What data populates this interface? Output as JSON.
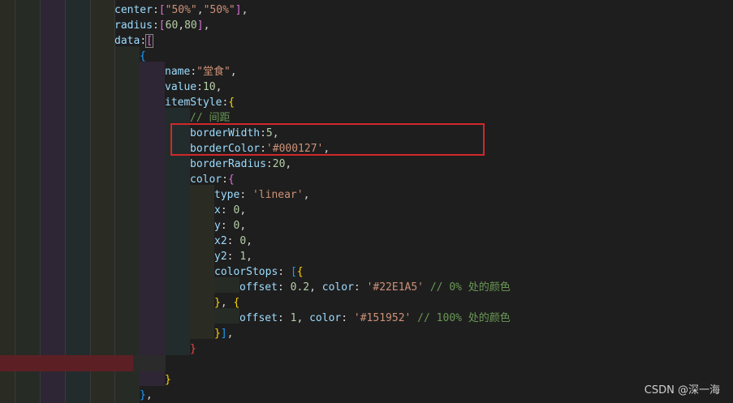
{
  "code": {
    "line1": {
      "key": "center",
      "sep": ":",
      "open": "[",
      "s1": "\"50%\"",
      "comma": ",",
      "s2": "\"50%\"",
      "close": "]",
      "end": ","
    },
    "line2": {
      "key": "radius",
      "sep": ":",
      "open": "[",
      "n1": "60",
      "comma": ",",
      "n2": "80",
      "close": "]",
      "end": ","
    },
    "line3": {
      "key": "data",
      "sep": ":",
      "open": "["
    },
    "line4": {
      "open": "{"
    },
    "line5": {
      "key": "name",
      "sep": ":",
      "val": "\"堂食\"",
      "end": ","
    },
    "line6": {
      "key": "value",
      "sep": ":",
      "val": "10",
      "end": ","
    },
    "line7": {
      "key": "itemStyle",
      "sep": ":",
      "open": "{"
    },
    "line8": {
      "comment": "// 间距"
    },
    "line9": {
      "key": "borderWidth",
      "sep": ":",
      "val": "5",
      "end": ","
    },
    "line10": {
      "key": "borderColor",
      "sep": ":",
      "val": "'#000127'",
      "end": ","
    },
    "line11": {
      "key": "borderRadius",
      "sep": ":",
      "val": "20",
      "end": ","
    },
    "line12": {
      "key": "color",
      "sep": ":",
      "open": "{"
    },
    "line13": {
      "key": "type",
      "sep": ": ",
      "val": "'linear'",
      "end": ","
    },
    "line14": {
      "key": "x",
      "sep": ": ",
      "val": "0",
      "end": ","
    },
    "line15": {
      "key": "y",
      "sep": ": ",
      "val": "0",
      "end": ","
    },
    "line16": {
      "key": "x2",
      "sep": ": ",
      "val": "0",
      "end": ","
    },
    "line17": {
      "key": "y2",
      "sep": ": ",
      "val": "1",
      "end": ","
    },
    "line18": {
      "key": "colorStops",
      "sep": ": ",
      "open": "[",
      "open2": "{"
    },
    "line19": {
      "key": "offset",
      "sep": ": ",
      "val": "0.2",
      "comma": ", ",
      "key2": "color",
      "sep2": ": ",
      "val2": "'#22E1A5'",
      "comment": " // 0% 处的颜色"
    },
    "line20": {
      "close": "}",
      "comma": ", ",
      "open": "{"
    },
    "line21": {
      "key": "offset",
      "sep": ": ",
      "val": "1",
      "comma": ", ",
      "key2": "color",
      "sep2": ": ",
      "val2": "'#151952'",
      "comment": " // 100% 处的颜色"
    },
    "line22": {
      "close": "}",
      "close2": "]",
      "end": ","
    },
    "line23": {
      "close": "}"
    },
    "line25": {
      "close": "}"
    },
    "line26": {
      "close": "}",
      "end": ","
    }
  },
  "watermark": "CSDN @深一海",
  "colors": {
    "background": "#1e1e1e",
    "highlight_box": "#d0282b",
    "error_band": "#5c2024"
  }
}
